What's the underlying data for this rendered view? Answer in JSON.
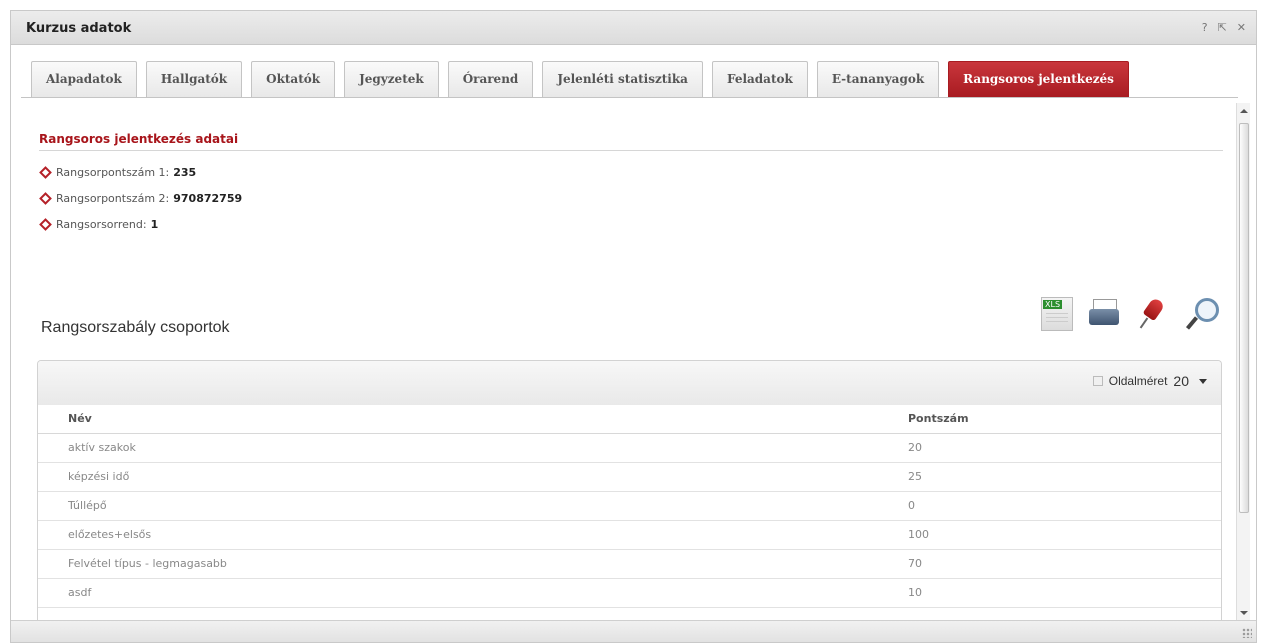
{
  "window": {
    "title": "Kurzus adatok",
    "buttons": {
      "help": "?",
      "popout": "⇱",
      "close": "✕"
    }
  },
  "tabs": [
    {
      "label": "Alapadatok",
      "active": false
    },
    {
      "label": "Hallgatók",
      "active": false
    },
    {
      "label": "Oktatók",
      "active": false
    },
    {
      "label": "Jegyzetek",
      "active": false
    },
    {
      "label": "Órarend",
      "active": false
    },
    {
      "label": "Jelenléti statisztika",
      "active": false
    },
    {
      "label": "Feladatok",
      "active": false
    },
    {
      "label": "E-tananyagok",
      "active": false
    },
    {
      "label": "Rangsoros jelentkezés",
      "active": true
    }
  ],
  "ranking_info": {
    "title": "Rangsoros jelentkezés adatai",
    "rows": [
      {
        "label": "Rangsorpontszám 1:",
        "value": "235"
      },
      {
        "label": "Rangsorpontszám 2:",
        "value": "970872759"
      },
      {
        "label": "Rangsorsorrend:",
        "value": "1"
      }
    ]
  },
  "groups": {
    "title": "Rangsorszabály csoportok",
    "toolbar_icons": [
      "excel-export-icon",
      "print-icon",
      "pin-icon",
      "search-icon"
    ],
    "pager": {
      "label": "Oldalméret",
      "page_size": "20"
    },
    "columns": {
      "name": "Név",
      "points": "Pontszám"
    },
    "rows": [
      {
        "name": "aktív szakok",
        "points": "20"
      },
      {
        "name": "képzési idő",
        "points": "25"
      },
      {
        "name": "Túllépő",
        "points": "0"
      },
      {
        "name": "előzetes+elsős",
        "points": "100"
      },
      {
        "name": "Felvétel típus - legmagasabb",
        "points": "70"
      },
      {
        "name": "asdf",
        "points": "10"
      }
    ]
  },
  "colors": {
    "accent": "#a8151b",
    "active_tab": "#b52128"
  }
}
